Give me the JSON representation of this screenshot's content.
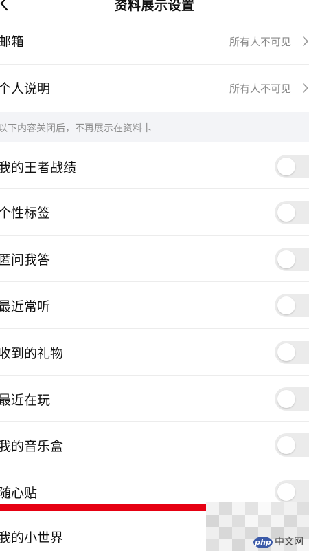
{
  "header": {
    "title": "资料展示设置",
    "back_icon": "chevron-left-icon"
  },
  "visibility_rows": [
    {
      "label": "邮箱",
      "value": "所有人不可见",
      "icon": "chevron-right-icon"
    },
    {
      "label": "个人说明",
      "value": "所有人不可见",
      "icon": "chevron-right-icon"
    }
  ],
  "section_note": "以下内容关闭后，不再展示在资料卡",
  "toggle_rows": [
    {
      "label": "我的王者战绩",
      "enabled": false
    },
    {
      "label": "个性标签",
      "enabled": false
    },
    {
      "label": "匿问我答",
      "enabled": false
    },
    {
      "label": "最近常听",
      "enabled": false
    },
    {
      "label": "收到的礼物",
      "enabled": false
    },
    {
      "label": "最近在玩",
      "enabled": false
    },
    {
      "label": "我的音乐盒",
      "enabled": false
    },
    {
      "label": "随心贴",
      "enabled": false
    },
    {
      "label": "我的小世界",
      "enabled": false
    }
  ],
  "watermark": {
    "logo_text": "php",
    "text": "中文网"
  },
  "colors": {
    "toggle_off": "#ebebeb",
    "secondary_text": "#8a8a8a",
    "section_bg": "#f3f4f7",
    "red_bar": "#e60012"
  }
}
